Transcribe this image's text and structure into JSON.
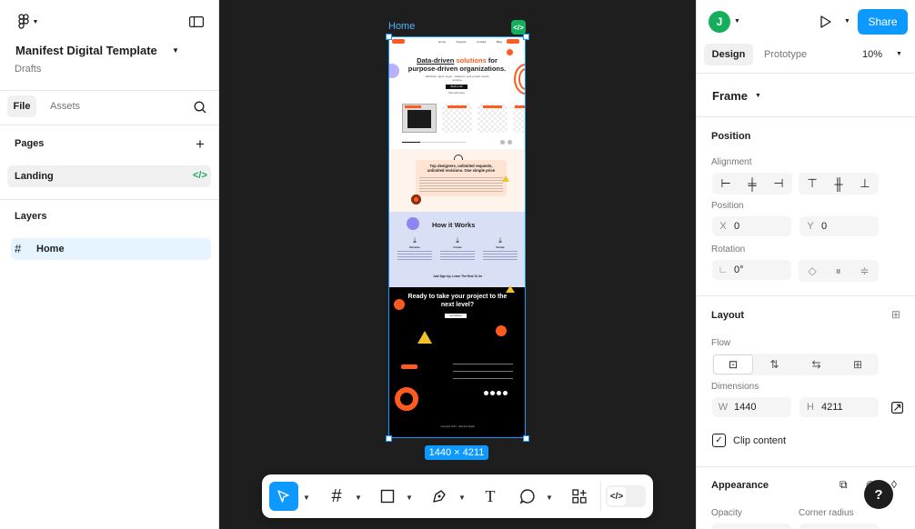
{
  "file": {
    "name": "Manifest Digital Template",
    "location": "Drafts"
  },
  "left_tabs": {
    "file": "File",
    "assets": "Assets"
  },
  "pages": {
    "title": "Pages",
    "items": [
      {
        "label": "Landing"
      }
    ]
  },
  "layers": {
    "title": "Layers",
    "items": [
      {
        "label": "Home"
      }
    ]
  },
  "canvas": {
    "frame_label": "Home",
    "dimension_badge": "1440 × 4211",
    "site": {
      "nav_links": [
        "Home",
        "Projects",
        "Contact",
        "Blog"
      ],
      "headline_1": "Data-driven",
      "headline_2": "solutions",
      "headline_3": "for",
      "headline_4": "purpose-driven organizations.",
      "subline": "Websites, apps, logos - whatever your project needs, anytime.",
      "cta": "Book a call",
      "cta_sub": "Start right away",
      "offer_title": "Top designers, unlimited requests, unlimited revisions. One simple price",
      "how_title": "How it Works",
      "how_steps": [
        "Receive",
        "Create",
        "Iterate"
      ],
      "how_footer": "Just Sign Up, Leave The Rest To Us",
      "ready_title": "Ready to take your project to the next level?",
      "ready_cta": "Get Started",
      "footer_copy": "Copyright 2024 · Manifest Digital"
    }
  },
  "right": {
    "avatar_initial": "J",
    "share": "Share",
    "tabs": {
      "design": "Design",
      "prototype": "Prototype"
    },
    "zoom": "10%",
    "frame_type": "Frame",
    "position": {
      "title": "Position",
      "alignment": "Alignment",
      "position_label": "Position",
      "x_label": "X",
      "x": "0",
      "y_label": "Y",
      "y": "0",
      "rotation_label": "Rotation",
      "rotation": "0°"
    },
    "layout": {
      "title": "Layout",
      "flow": "Flow",
      "dimensions": "Dimensions",
      "w_label": "W",
      "w": "1440",
      "h_label": "H",
      "h": "4211",
      "clip": "Clip content"
    },
    "appearance": {
      "title": "Appearance",
      "opacity": "Opacity",
      "corner_radius": "Corner radius"
    }
  },
  "help": "?",
  "colors": {
    "accent": "#0d99ff",
    "brand_orange": "#ff5a1f",
    "layer_selected": "#e5f4ff",
    "dev_green": "#14ae5c"
  }
}
